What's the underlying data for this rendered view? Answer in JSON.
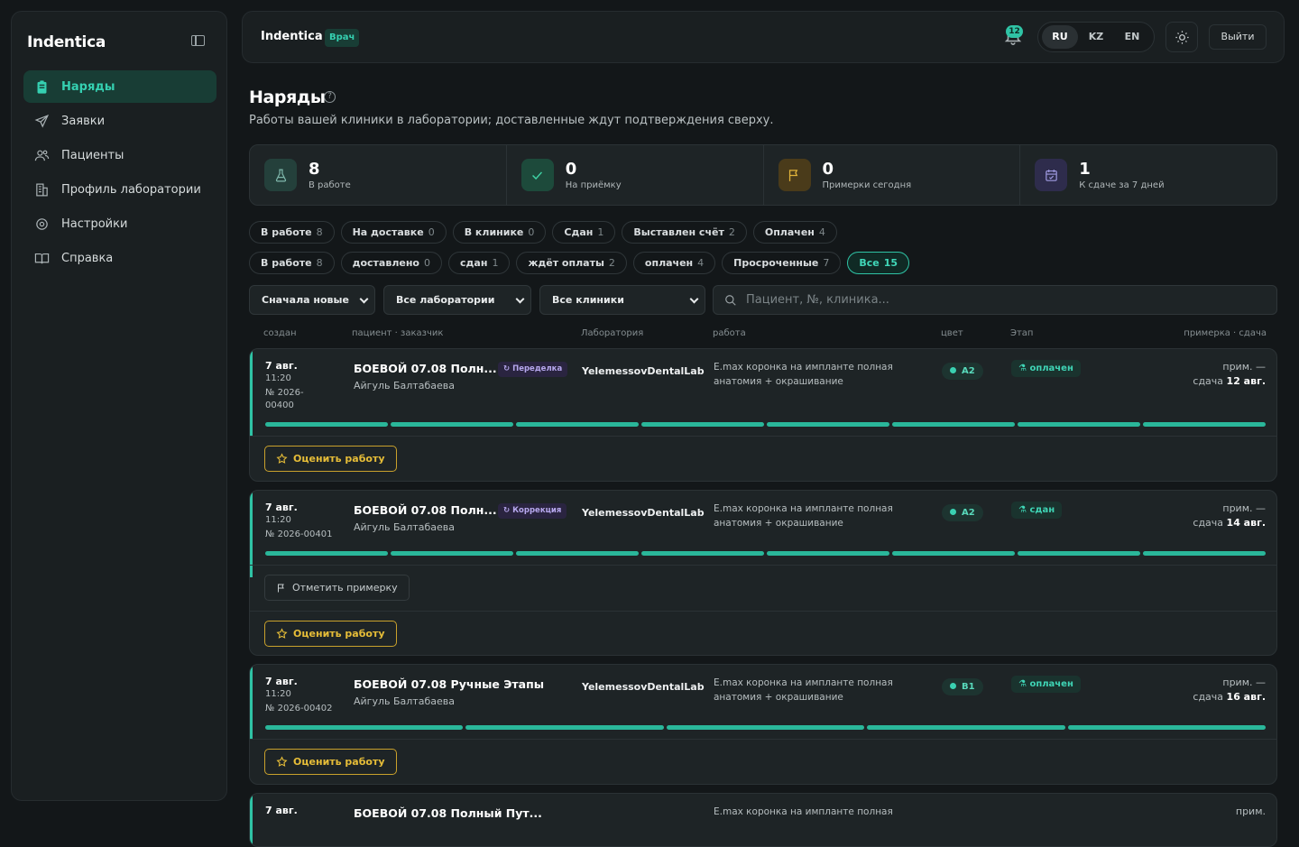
{
  "app": {
    "name": "Indentica"
  },
  "sidebar": {
    "items": [
      {
        "label": "Наряды",
        "icon": "clipboard-icon",
        "active": true
      },
      {
        "label": "Заявки",
        "icon": "send-icon",
        "active": false
      },
      {
        "label": "Пациенты",
        "icon": "users-icon",
        "active": false
      },
      {
        "label": "Профиль лаборатории",
        "icon": "building-icon",
        "active": false
      },
      {
        "label": "Настройки",
        "icon": "gear-icon",
        "active": false
      },
      {
        "label": "Справка",
        "icon": "book-icon",
        "active": false
      }
    ]
  },
  "header": {
    "brand": "Indentica",
    "role": "Врач",
    "notifications": "12",
    "languages": [
      "RU",
      "KZ",
      "EN"
    ],
    "active_language": "RU",
    "logout": "Выйти"
  },
  "page": {
    "title": "Наряды",
    "help": "?",
    "subtitle": "Работы вашей клиники в лаборатории; доставленные ждут подтверждения сверху."
  },
  "stats": [
    {
      "value": "8",
      "label": "В работе",
      "icon": "flask-icon",
      "color": "#24403b"
    },
    {
      "value": "0",
      "label": "На приёмку",
      "icon": "check-icon",
      "color": "#1d4a3b"
    },
    {
      "value": "0",
      "label": "Примерки сегодня",
      "icon": "flag-icon",
      "color": "#4a3b1a"
    },
    {
      "value": "1",
      "label": "К сдаче за 7 дней",
      "icon": "calendar-icon",
      "color": "#2e2c4c"
    }
  ],
  "chips_row1": [
    {
      "label": "В работе",
      "count": "8"
    },
    {
      "label": "На доставке",
      "count": "0"
    },
    {
      "label": "В клинике",
      "count": "0"
    },
    {
      "label": "Сдан",
      "count": "1"
    },
    {
      "label": "Выставлен счёт",
      "count": "2"
    },
    {
      "label": "Оплачен",
      "count": "4"
    }
  ],
  "chips_row2": [
    {
      "label": "В работе",
      "count": "8"
    },
    {
      "label": "доставлено",
      "count": "0"
    },
    {
      "label": "сдан",
      "count": "1"
    },
    {
      "label": "ждёт оплаты",
      "count": "2"
    },
    {
      "label": "оплачен",
      "count": "4"
    },
    {
      "label": "Просроченные",
      "count": "7"
    },
    {
      "label": "Все",
      "count": "15",
      "selected": true
    }
  ],
  "filters": {
    "sort": "Сначала новые",
    "labs": "Все лаборатории",
    "clinics": "Все клиники",
    "search_placeholder": "Пациент, №, клиника..."
  },
  "columns": {
    "created": "создан",
    "patient": "пациент · заказчик",
    "lab": "Лаборатория",
    "work": "работа",
    "color": "цвет",
    "stage": "Этап",
    "deadline": "примерка · сдача"
  },
  "orders": [
    {
      "date": "7 авг.",
      "time": "11:20",
      "number": "№ 2026-00400",
      "title": "БОЕВОЙ 07.08 Полн...",
      "tag": "Переделка",
      "patient": "Айгуль Балтабаева",
      "lab": "YelemessovDentalLab",
      "work": "E.max коронка на импланте полная анатомия + окрашивание",
      "shade": "A2",
      "stage": "оплачен",
      "fitting": "прим. —",
      "due_prefix": "сдача",
      "due": "12 авг.",
      "progress_segments": 8,
      "fitting_button": null,
      "rate_button": "Оценить работу"
    },
    {
      "date": "7 авг.",
      "time": "11:20",
      "number": "№ 2026-00401",
      "title": "БОЕВОЙ 07.08 Полн...",
      "tag": "Коррекция",
      "patient": "Айгуль Балтабаева",
      "lab": "YelemessovDentalLab",
      "work": "E.max коронка на импланте полная анатомия + окрашивание",
      "shade": "A2",
      "stage": "сдан",
      "fitting": "прим. —",
      "due_prefix": "сдача",
      "due": "14 авг.",
      "progress_segments": 8,
      "fitting_button": "Отметить примерку",
      "rate_button": "Оценить работу"
    },
    {
      "date": "7 авг.",
      "time": "11:20",
      "number": "№ 2026-00402",
      "title": "БОЕВОЙ 07.08 Ручные Этапы",
      "tag": null,
      "patient": "Айгуль Балтабаева",
      "lab": "YelemessovDentalLab",
      "work": "E.max коронка на импланте полная анатомия + окрашивание",
      "shade": "B1",
      "stage": "оплачен",
      "fitting": "прим. —",
      "due_prefix": "сдача",
      "due": "16 авг.",
      "progress_segments": 5,
      "fitting_button": null,
      "rate_button": "Оценить работу"
    },
    {
      "date": "7 авг.",
      "time": "",
      "number": "",
      "title": "БОЕВОЙ 07.08 Полный Пут...",
      "tag": null,
      "patient": "",
      "lab": "",
      "work": "E.max коронка на импланте полная",
      "shade": "",
      "stage": "",
      "fitting": "прим.",
      "due_prefix": "",
      "due": "",
      "progress_segments": 0,
      "fitting_button": null,
      "rate_button": null
    }
  ]
}
